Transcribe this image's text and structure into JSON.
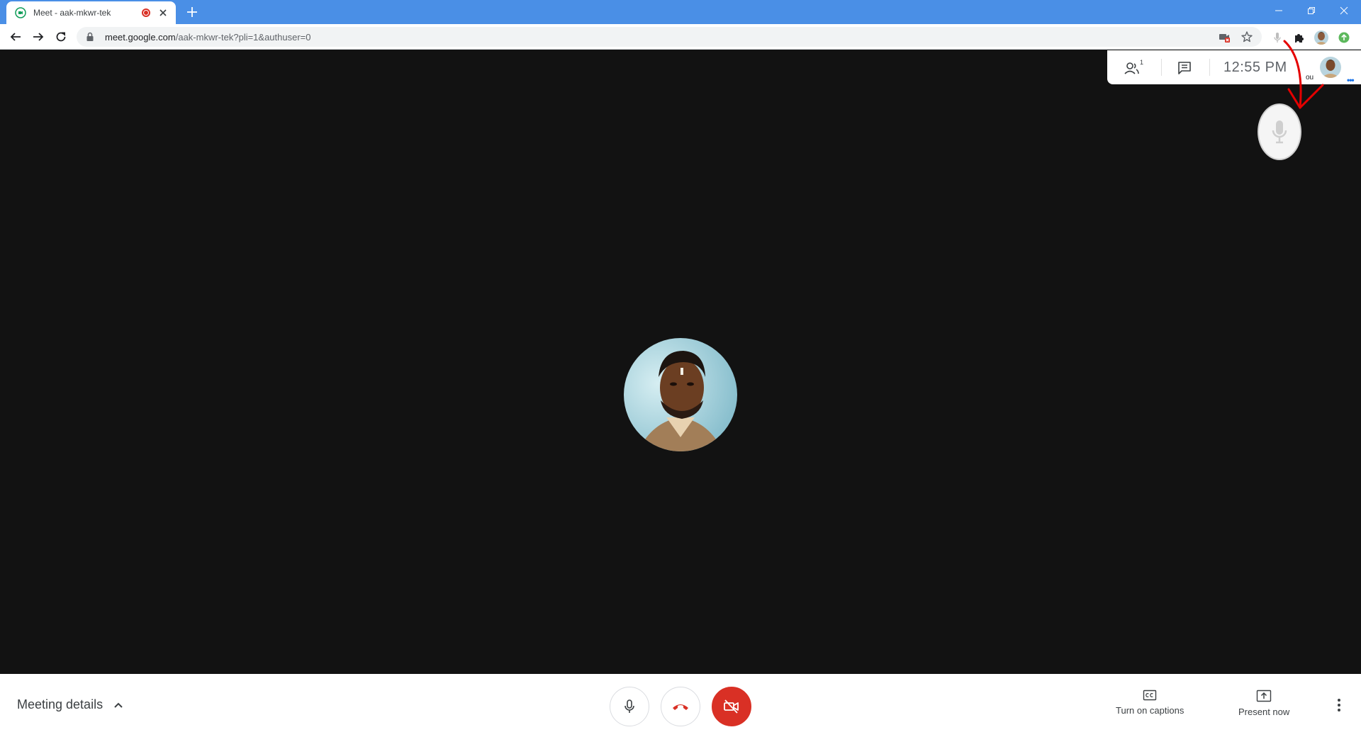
{
  "browser": {
    "tab_title": "Meet - aak-mkwr-tek",
    "url_host": "meet.google.com",
    "url_path": "/aak-mkwr-tek?pli=1&authuser=0"
  },
  "meet": {
    "participants_count": "1",
    "clock": "12:55 PM",
    "self_label": "ou",
    "meeting_details_label": "Meeting details",
    "captions_label": "Turn on captions",
    "present_label": "Present now"
  },
  "colors": {
    "titlebar": "#4a8fe6",
    "stage": "#121212",
    "danger": "#d93025",
    "annotation": "#e50000"
  },
  "icons": {
    "favicon": "meet-icon",
    "tab_recording": "recording-dot-icon",
    "back": "arrow-back-icon",
    "forward": "arrow-forward-icon",
    "reload": "reload-icon",
    "lock": "lock-icon",
    "cast_blocked": "camera-blocked-icon",
    "bookmark": "star-icon",
    "mic_extension": "mic-icon",
    "extensions": "puzzle-icon",
    "people": "people-icon",
    "chat": "chat-icon",
    "captions": "cc-icon",
    "present": "present-icon",
    "more": "more-vert-icon"
  }
}
